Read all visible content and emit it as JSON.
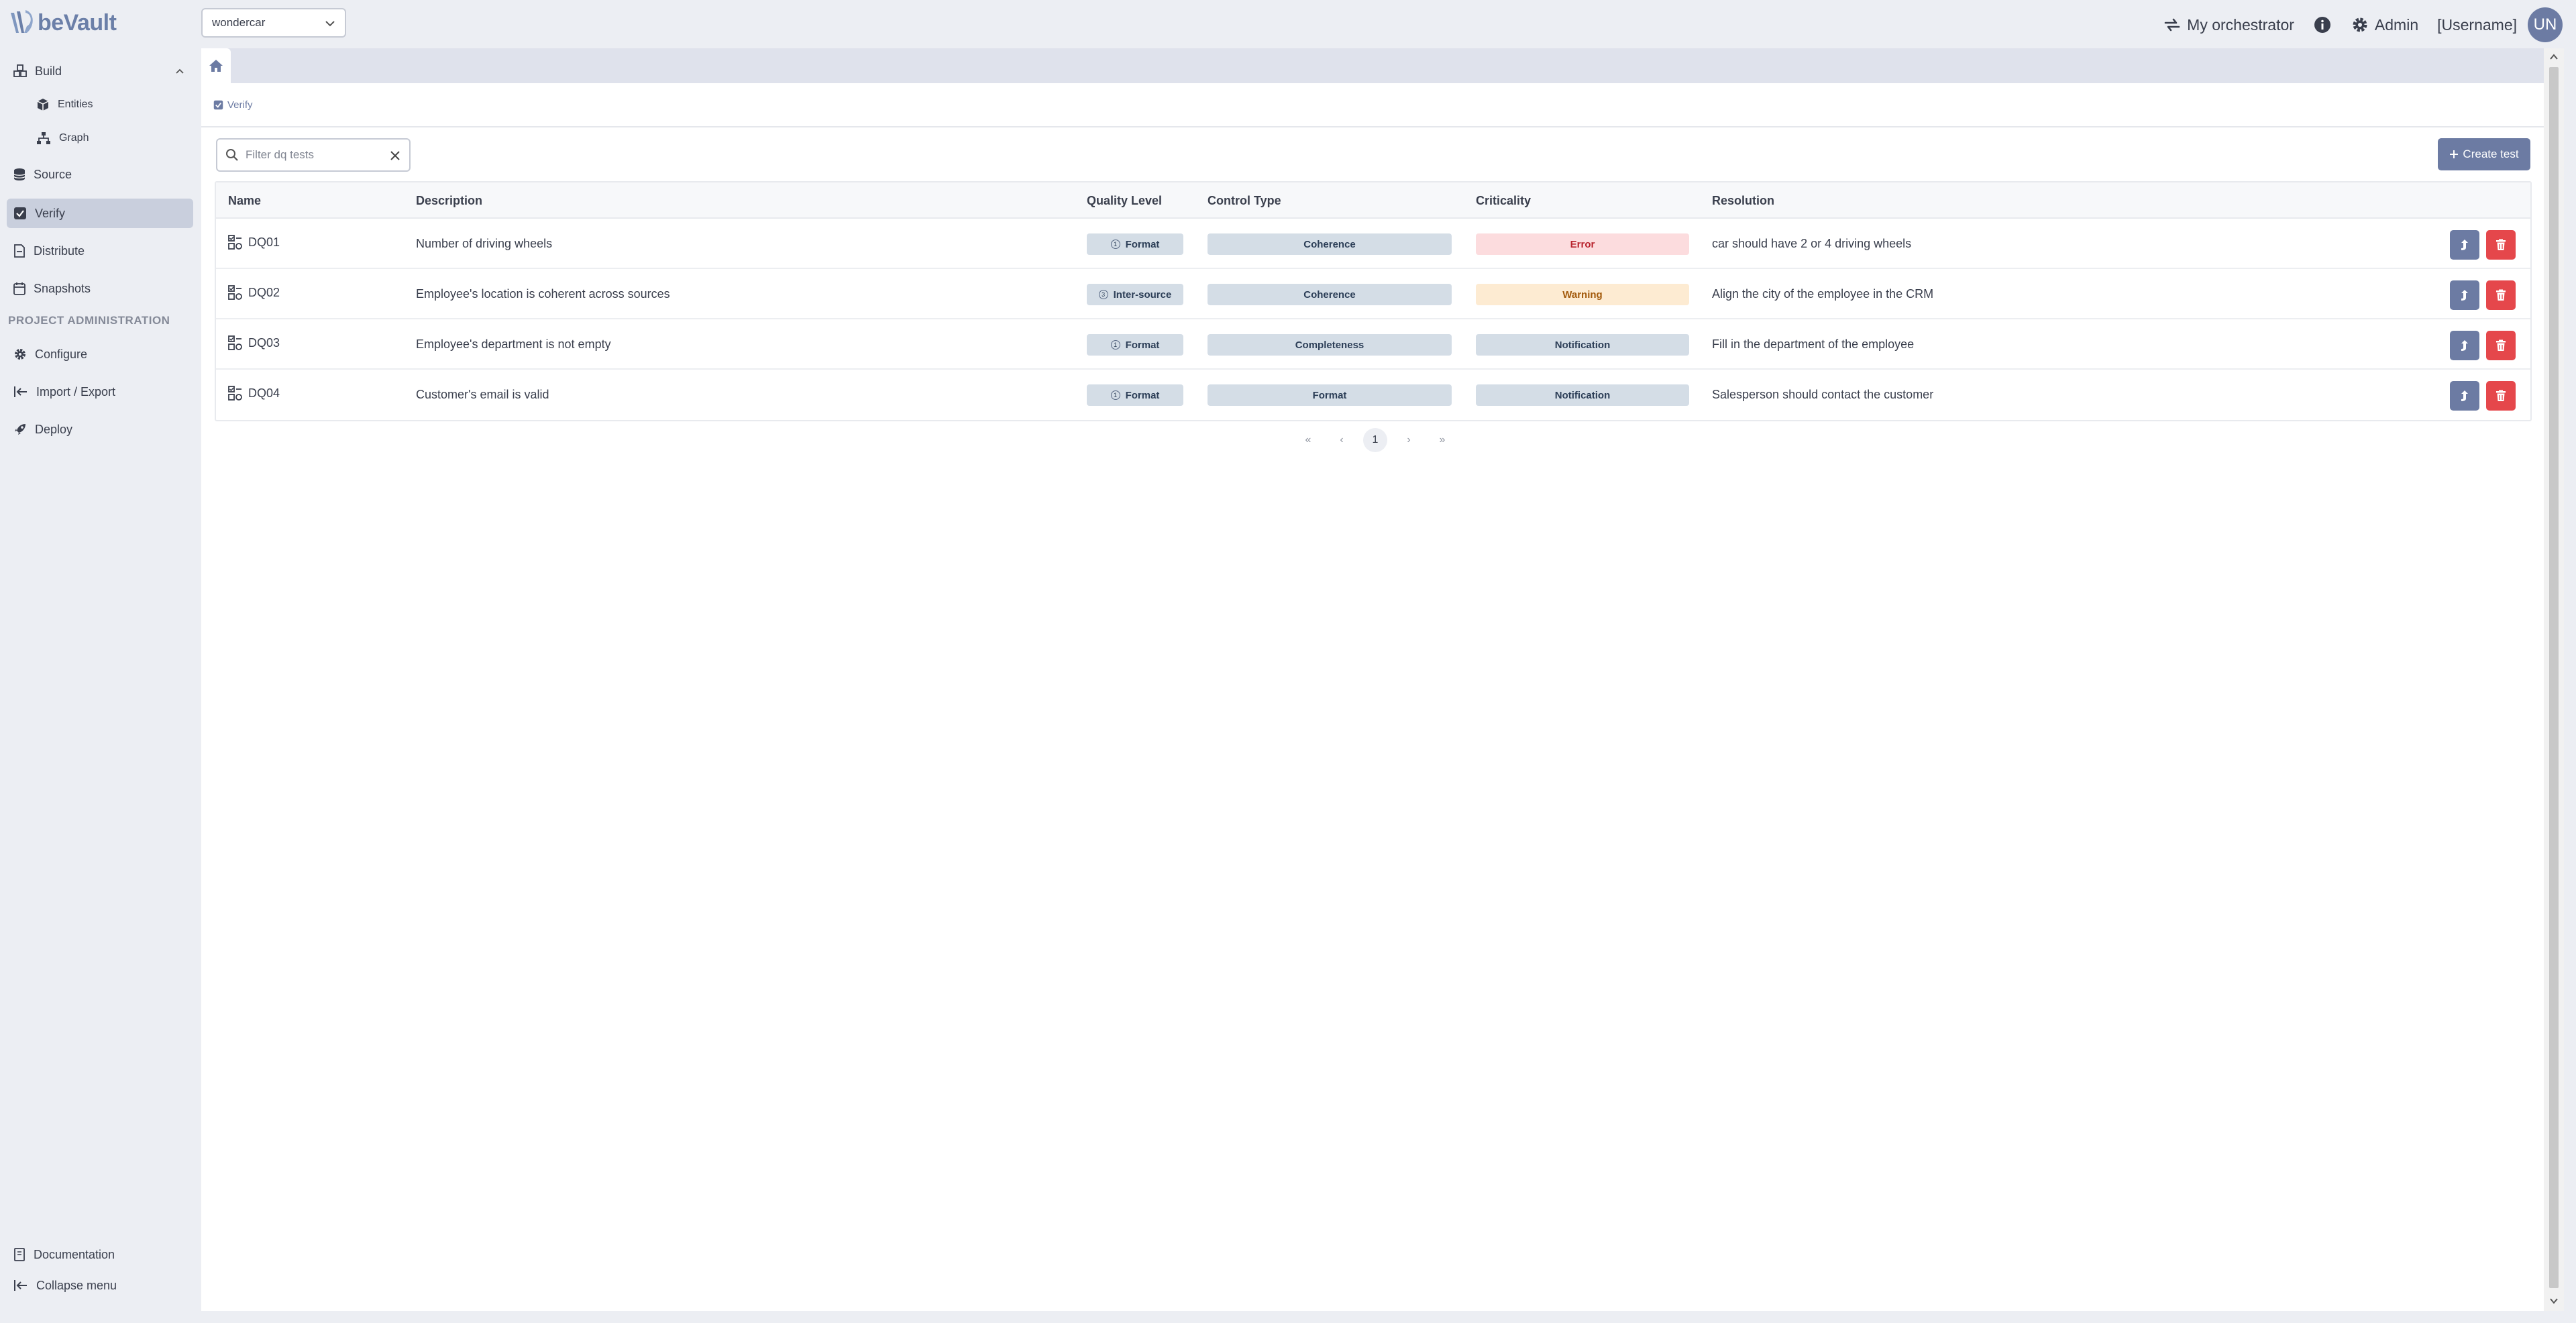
{
  "app": {
    "logo_text": "beVault",
    "project_selected": "wondercar"
  },
  "topbar": {
    "orchestrator": "My orchestrator",
    "admin": "Admin",
    "username": "[Username]",
    "avatar_initials": "UN"
  },
  "sidebar": {
    "build": "Build",
    "entities": "Entities",
    "graph": "Graph",
    "source": "Source",
    "verify": "Verify",
    "distribute": "Distribute",
    "snapshots": "Snapshots",
    "section_admin": "PROJECT ADMINISTRATION",
    "configure": "Configure",
    "import_export": "Import / Export",
    "deploy": "Deploy",
    "documentation": "Documentation",
    "collapse": "Collapse menu"
  },
  "breadcrumb": {
    "label": "Verify"
  },
  "filter": {
    "placeholder": "Filter dq tests",
    "value": ""
  },
  "create_button": "Create test",
  "table": {
    "headers": {
      "name": "Name",
      "description": "Description",
      "quality_level": "Quality Level",
      "control_type": "Control Type",
      "criticality": "Criticality",
      "resolution": "Resolution"
    },
    "rows": [
      {
        "name": "DQ01",
        "description": "Number of driving wheels",
        "ql_num": "1",
        "quality_level": "Format",
        "control_type": "Coherence",
        "criticality": "Error",
        "resolution": "car should have 2 or 4 driving wheels"
      },
      {
        "name": "DQ02",
        "description": "Employee's location is coherent across sources",
        "ql_num": "3",
        "quality_level": "Inter-source",
        "control_type": "Coherence",
        "criticality": "Warning",
        "resolution": "Align the city of the employee in the CRM"
      },
      {
        "name": "DQ03",
        "description": "Employee's department is not empty",
        "ql_num": "1",
        "quality_level": "Format",
        "control_type": "Completeness",
        "criticality": "Notification",
        "resolution": "Fill in the department of the employee"
      },
      {
        "name": "DQ04",
        "description": "Customer's email is valid",
        "ql_num": "1",
        "quality_level": "Format",
        "control_type": "Format",
        "criticality": "Notification",
        "resolution": "Salesperson should contact the customer"
      }
    ]
  },
  "pagination": {
    "first": "«",
    "prev": "‹",
    "current": "1",
    "next": "›",
    "last": "»"
  },
  "colors": {
    "accent": "#6c7ba3",
    "danger": "#e5474b",
    "error_bg": "#fcdcde",
    "warning_bg": "#fdebd2",
    "neutral_pill": "#d4dde6"
  }
}
